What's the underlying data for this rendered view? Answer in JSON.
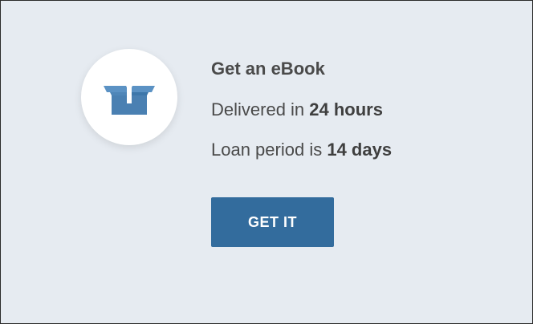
{
  "card": {
    "icon": "open-box-icon",
    "title": "Get an eBook",
    "delivery": {
      "prefix": "Delivered in ",
      "value": "24 hours"
    },
    "loan": {
      "prefix": "Loan period is ",
      "value": "14 days"
    },
    "button_label": "GET IT"
  },
  "colors": {
    "background": "#e6ebf1",
    "accent": "#336c9d",
    "text": "#4a4a4a"
  }
}
